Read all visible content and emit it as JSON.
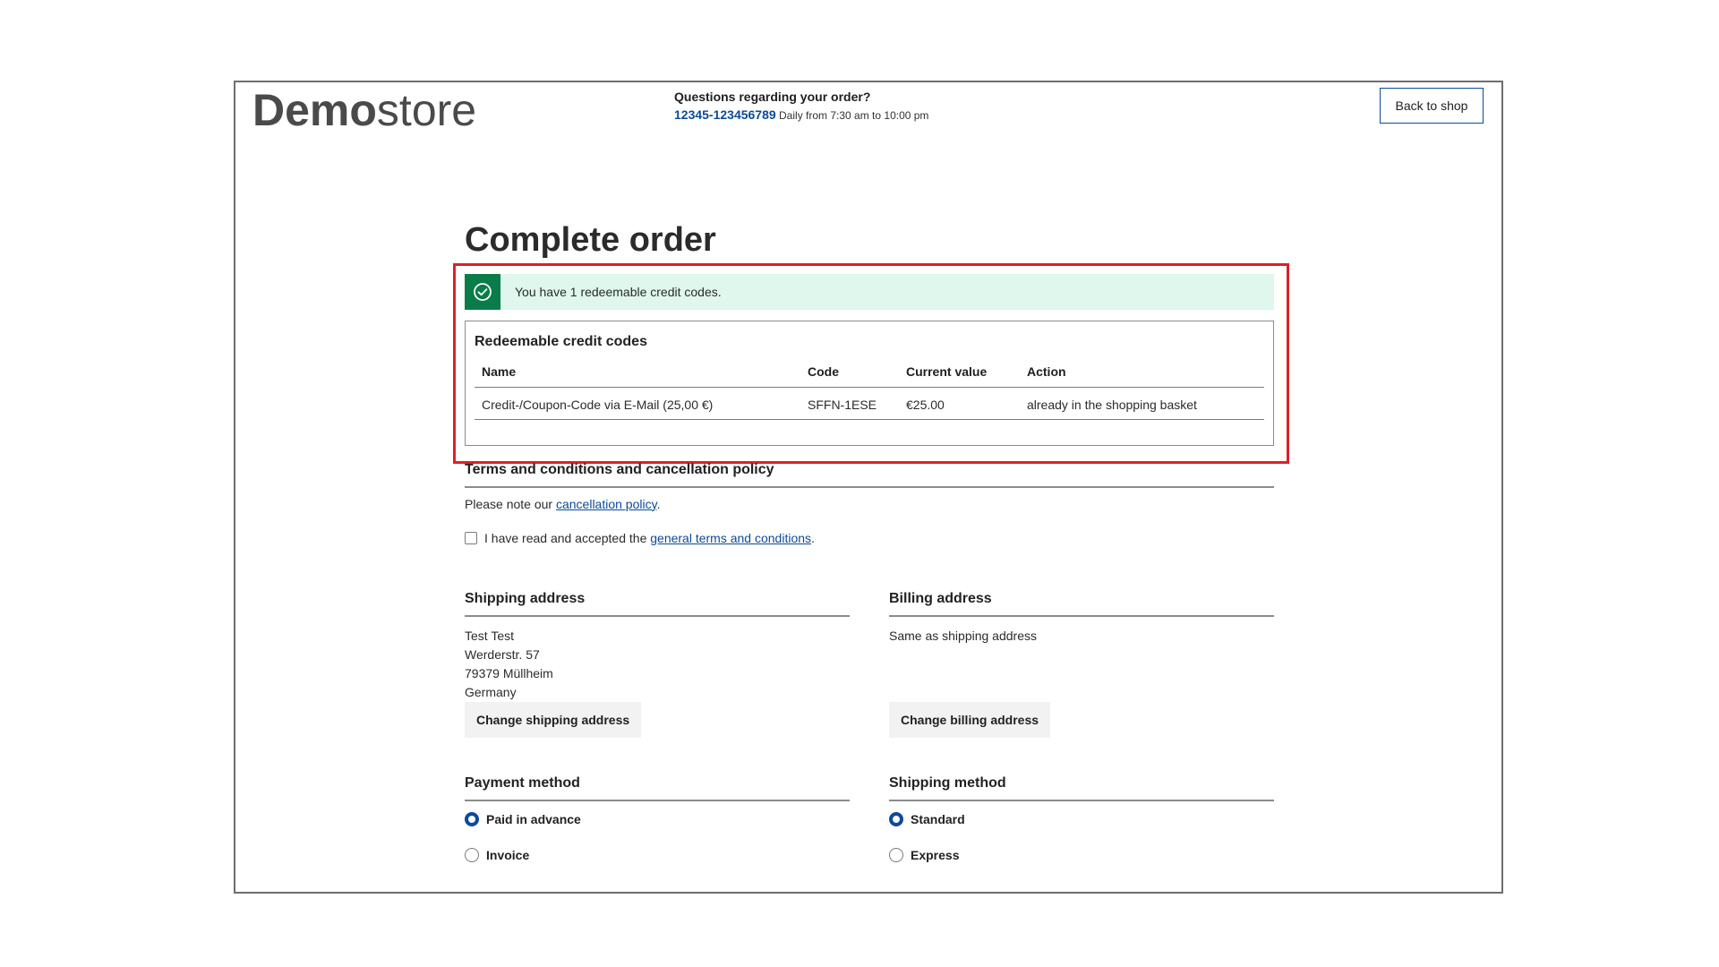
{
  "header": {
    "logo_bold": "Demo",
    "logo_light": "store",
    "contact_question": "Questions regarding your order?",
    "contact_phone": "12345-123456789",
    "contact_hours": "Daily from 7:30 am to 10:00 pm",
    "back_button": "Back to shop"
  },
  "page_title": "Complete order",
  "alert": {
    "text": "You have 1 redeemable credit codes.",
    "icon": "check-circle-icon",
    "color": "#0a7c4a"
  },
  "credit_codes": {
    "title": "Redeemable credit codes",
    "columns": [
      "Name",
      "Code",
      "Current value",
      "Action"
    ],
    "rows": [
      {
        "name": "Credit-/Coupon-Code via E-Mail (25,00 €)",
        "code": "SFFN-1ESE",
        "value": "€25.00",
        "action": "already in the shopping basket"
      }
    ]
  },
  "terms": {
    "title": "Terms and conditions and cancellation policy",
    "note_prefix": "Please note our ",
    "note_link": "cancellation policy",
    "note_suffix": ".",
    "checkbox_prefix": "I have read and accepted the ",
    "checkbox_link": "general terms and conditions",
    "checkbox_suffix": "."
  },
  "shipping_address": {
    "title": "Shipping address",
    "lines": [
      "Test Test",
      "Werderstr. 57",
      "79379 Müllheim",
      "Germany"
    ],
    "button": "Change shipping address"
  },
  "billing_address": {
    "title": "Billing address",
    "text": "Same as shipping address",
    "button": "Change billing address"
  },
  "payment_method": {
    "title": "Payment method",
    "options": [
      {
        "label": "Paid in advance",
        "selected": true
      },
      {
        "label": "Invoice",
        "selected": false
      }
    ]
  },
  "shipping_method": {
    "title": "Shipping method",
    "options": [
      {
        "label": "Standard",
        "selected": true
      },
      {
        "label": "Express",
        "selected": false
      }
    ]
  },
  "colors": {
    "brand_blue": "#0b4a9b",
    "highlight_red": "#e01f26",
    "alert_bg": "#dff7ec"
  }
}
